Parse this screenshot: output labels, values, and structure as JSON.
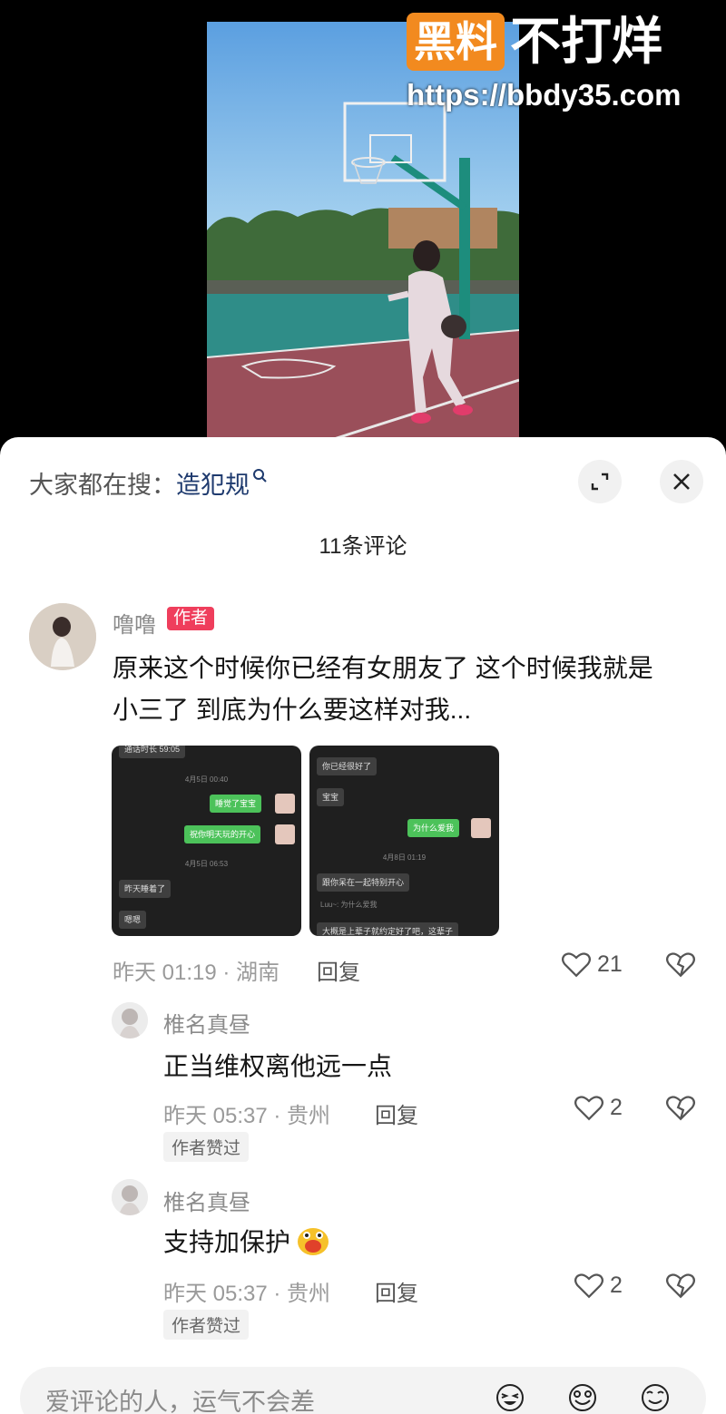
{
  "watermark": {
    "brand": "黑料",
    "slogan": "不打烊",
    "url": "https://bbdy35.com"
  },
  "search": {
    "label": "大家都在搜：",
    "term": "造犯规"
  },
  "comment_count": "11条评论",
  "comments": [
    {
      "user": "噜噜",
      "tag": "作者",
      "text_line1": "原来这个时候你已经有女朋友了 这个时候我就是",
      "text_line2": "小三了 到底为什么要这样对我...",
      "time": "昨天 01:19 · 湖南",
      "reply": "回复",
      "likes": "21"
    },
    {
      "user": "椎名真昼",
      "text": "正当维权离他远一点",
      "time": "昨天 05:37 · 贵州",
      "reply": "回复",
      "likes": "2",
      "badge": "作者赞过"
    },
    {
      "user": "椎名真昼",
      "text": "支持加保护",
      "time": "昨天 05:37 · 贵州",
      "reply": "回复",
      "likes": "2",
      "badge": "作者赞过"
    }
  ],
  "chat1": {
    "top": "通话时长 59:05",
    "t1": "4月5日 00:40",
    "m1": "睡觉了宝宝",
    "m2": "祝你明天玩的开心",
    "t2": "4月5日 06:53",
    "m3": "昨天睡着了",
    "m4": "嗯嗯"
  },
  "chat2": {
    "m1": "你已经很好了",
    "m2": "宝宝",
    "m3": "为什么爱我",
    "t1": "4月8日 01:19",
    "m4": "跟你呆在一起特别开心",
    "m5": "Luu~: 为什么爱我",
    "m6": "大概是上辈子就约定好了吧，这辈子"
  },
  "input": {
    "placeholder": "爱评论的人，运气不会差"
  },
  "colors": {
    "author_tag": "#ef3e5c",
    "search_term": "#1e3a6e",
    "watermark_badge": "#f28a1f"
  }
}
